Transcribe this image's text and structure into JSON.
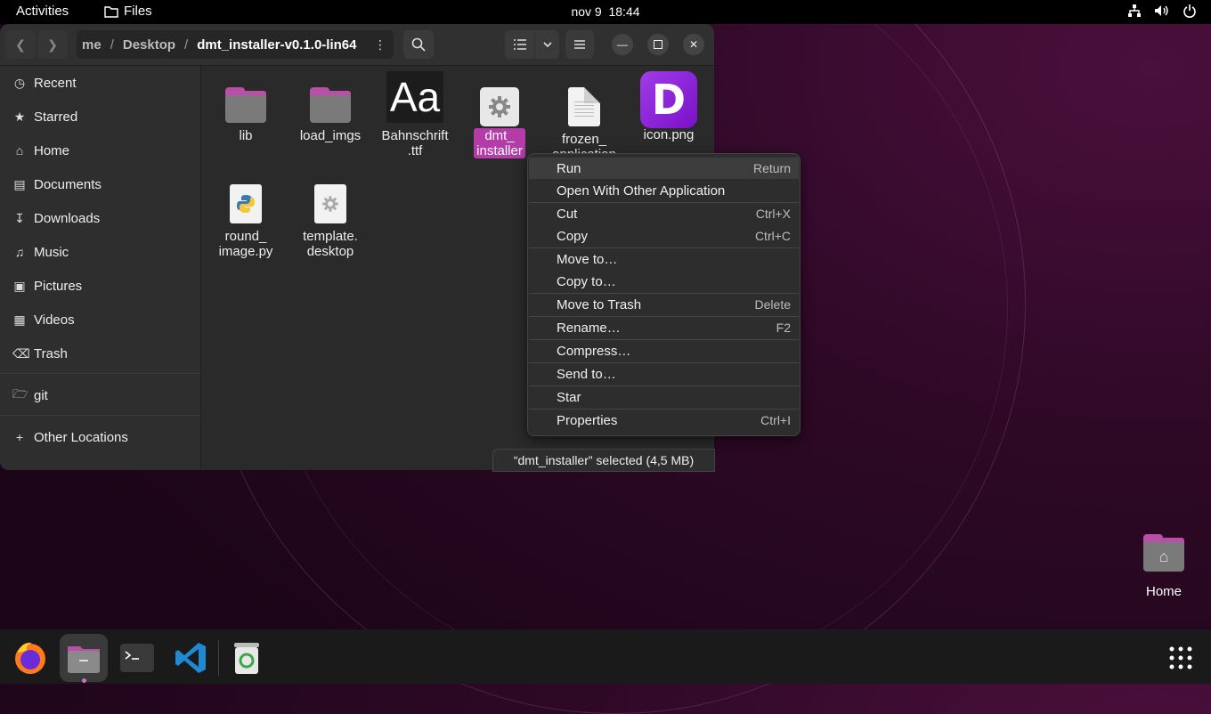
{
  "topbar": {
    "activities": "Activities",
    "app_name": "Files",
    "date": "nov 9",
    "time": "18:44"
  },
  "window": {
    "path": {
      "segment_home": "me",
      "segment_desktop": "Desktop",
      "segment_current": "dmt_installer-v0.1.0-lin64"
    },
    "sidebar": {
      "recent": "Recent",
      "starred": "Starred",
      "home": "Home",
      "documents": "Documents",
      "downloads": "Downloads",
      "music": "Music",
      "pictures": "Pictures",
      "videos": "Videos",
      "trash": "Trash",
      "git": "git",
      "other_locations": "Other Locations"
    },
    "files": {
      "lib": "lib",
      "load_imgs": "load_imgs",
      "bahnschrift_1": "Bahnschrift",
      "bahnschrift_2": ".ttf",
      "dmt_1": "dmt_",
      "dmt_2": "installer",
      "frozen_1": "frozen_",
      "frozen_2": "application",
      "icon_png": "icon.png",
      "round_1": "round_",
      "round_2": "image.py",
      "template_1": "template.",
      "template_2": "desktop",
      "font_preview": "Aa",
      "icon_letter": "D"
    },
    "status": "“dmt_installer” selected  (4,5 MB)"
  },
  "context_menu": {
    "run": "Run",
    "run_sc": "Return",
    "open_with": "Open With Other Application",
    "cut": "Cut",
    "cut_sc": "Ctrl+X",
    "copy": "Copy",
    "copy_sc": "Ctrl+C",
    "move_to": "Move to…",
    "copy_to": "Copy to…",
    "move_trash": "Move to Trash",
    "move_trash_sc": "Delete",
    "rename": "Rename…",
    "rename_sc": "F2",
    "compress": "Compress…",
    "send_to": "Send to…",
    "star": "Star",
    "properties": "Properties",
    "properties_sc": "Ctrl+I"
  },
  "desktop": {
    "home_label": "Home"
  },
  "colors": {
    "accent": "#b43ca8",
    "folder_tab": "#b94fa8",
    "icon_bg": "#8a1fd8"
  }
}
